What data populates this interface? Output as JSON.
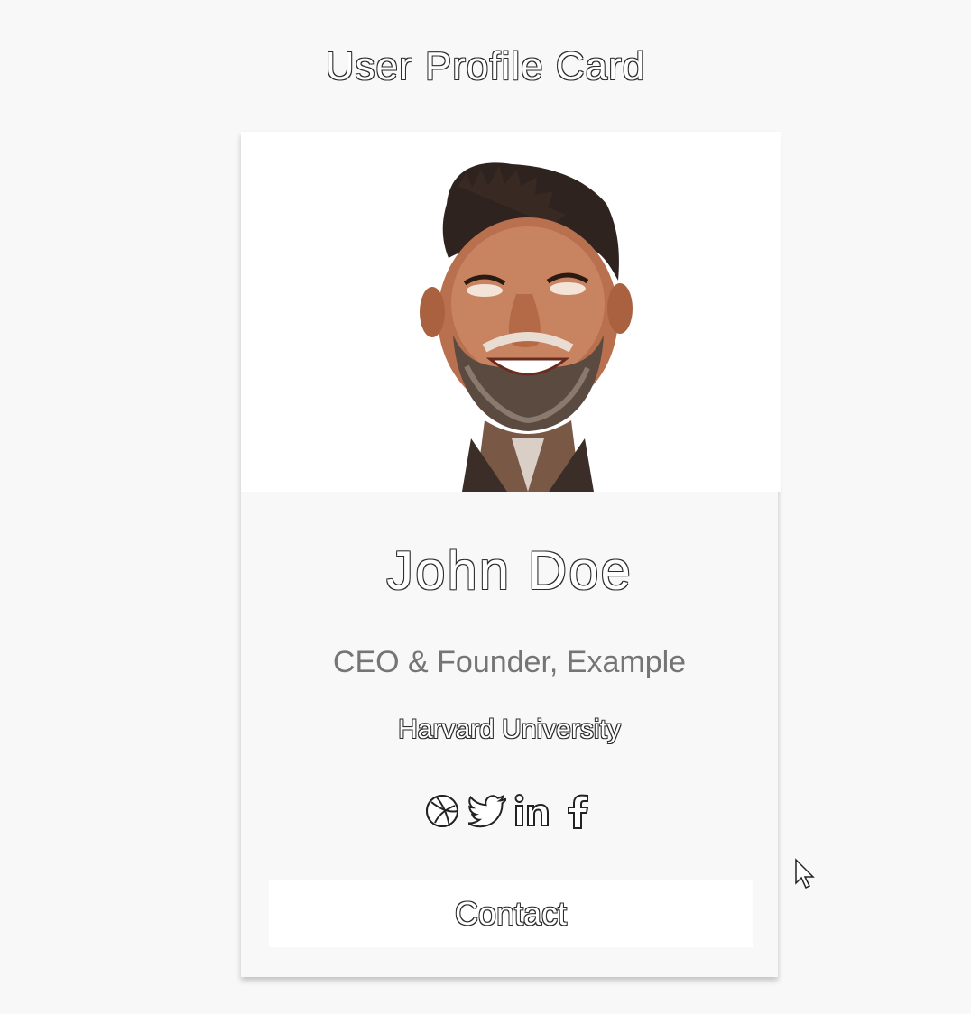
{
  "page": {
    "title": "User Profile Card"
  },
  "profile": {
    "name": "John Doe",
    "role": "CEO & Founder, Example",
    "school": "Harvard University",
    "photo_alt": "John",
    "social_icons": [
      "dribbble-icon",
      "twitter-icon",
      "linkedin-icon",
      "facebook-icon"
    ],
    "contact_label": "Contact"
  },
  "colors": {
    "background": "#f8f8f8",
    "card_photo_bg": "#ffffff",
    "role_text": "#757575",
    "outline": "#2b2b2b",
    "button_bg": "#ffffff"
  }
}
